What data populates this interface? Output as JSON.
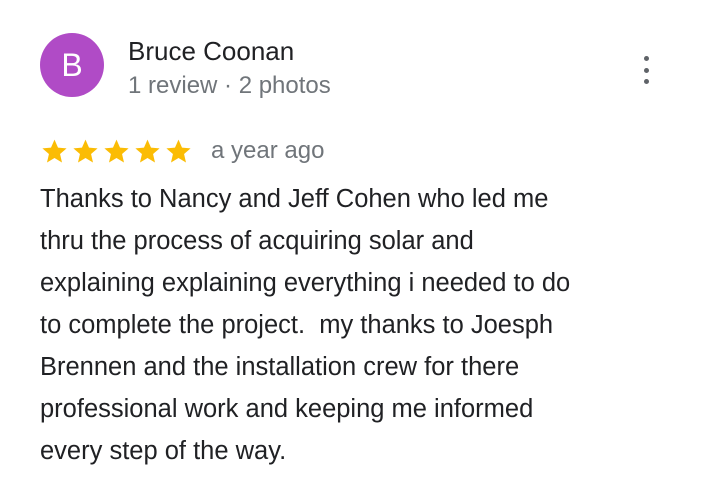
{
  "reviewer": {
    "initial": "B",
    "name": "Bruce Coonan",
    "meta": "1 review · 2 photos",
    "avatar_color": "#b04bc6"
  },
  "menu": {
    "icon": "more-vert-icon"
  },
  "rating": {
    "stars": 5,
    "star_color": "#fbbc04",
    "time_ago": "a year ago"
  },
  "review": {
    "lines": [
      "Thanks to Nancy and Jeff Cohen who led me",
      "thru the process of acquiring solar and",
      "explaining explaining everything i needed to do",
      "to complete the project.  my thanks to Joesph",
      "Brennen and the installation crew for there",
      "professional work and keeping me informed",
      "every step of the way."
    ]
  }
}
